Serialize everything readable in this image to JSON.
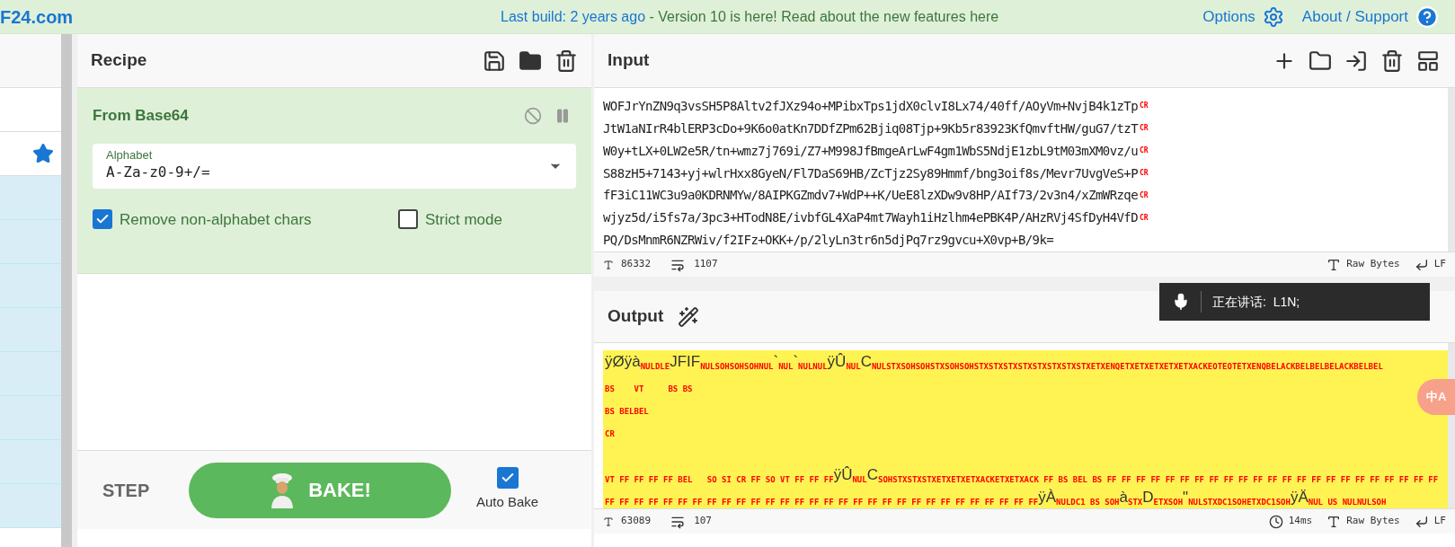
{
  "banner": {
    "logo": "F24.com",
    "build_link": "Last build: 2 years ago",
    "notice": " - Version 10 is here! Read about the new features here",
    "options": "Options",
    "about": "About / Support"
  },
  "recipe": {
    "title": "Recipe",
    "operation": {
      "name": "From Base64",
      "disabled": false,
      "paused": false,
      "alphabet_label": "Alphabet",
      "alphabet": "A-Za-z0-9+/=",
      "checkboxes": [
        {
          "label": "Remove non-alphabet chars",
          "checked": true
        },
        {
          "label": "Strict mode",
          "checked": false
        }
      ]
    },
    "step": "STEP",
    "bake": "BAKE!",
    "auto_bake": {
      "label": "Auto Bake",
      "checked": true
    }
  },
  "input": {
    "title": "Input",
    "lines": [
      {
        "text": "WOFJrYnZN9q3vsSH5P8Altv2fJXz94o+MPibxTps1jdX0clvI8Lx74/40ff/AOyVm+NvjB4k1zTp",
        "end": "CR"
      },
      {
        "text": "JtW1aNIrR4blERP3cDo+9K6o0atKn7DDfZPm62Bjiq08Tjp+9Kb5r83923KfQmvftHW/guG7/tzT",
        "end": "CR"
      },
      {
        "text": "W0y+tLX+0LW2e5R/tn+wmz7j769i/Z7+M998JfBmgeArLwF4gm1WbS5NdjE1zbL9tM03mXM0vz/u",
        "end": "CR"
      },
      {
        "text": "S88zH5+7143+yj+wlrHxx8GyeN/Fl7DaS69HB/ZcTjz2Sy89Hmmf/bng3oif8s/Mevr7UvgVeS+P",
        "end": "CR"
      },
      {
        "text": "fF3iC11WC3u9a0KDRNMYw/8AIPKGZmdv7+WdP++K/UeE8lzXDw9v8HP/AIf73/2v3n4/xZmWRzqe",
        "end": "CR"
      },
      {
        "text": "wjyz5d/i5fs7a/3pc3+HTodN8E/ivbfGL4XaP4mt7Wayh1iHzlhm4ePBK4P/AHzRVj4SfDyH4VfD",
        "end": "CR"
      },
      {
        "text": "PQ/DsMnmR6NZRWiv/f2IFz+OKK+/p/2lyLn3tr6n5djPq7rz9gvcu+X0vp+B/9k="
      }
    ],
    "length": "86332",
    "lines_count": "1107",
    "encoding": "Raw Bytes",
    "eol": "LF"
  },
  "output": {
    "title": "Output",
    "lines": [
      {
        "kind": "text",
        "segments": [
          {
            "kind": "char",
            "text": "ÿØÿà"
          },
          {
            "kind": "ctrl",
            "text": "NULDLE"
          },
          {
            "kind": "char",
            "text": "JFIF"
          },
          {
            "kind": "ctrl",
            "text": "NULSOHSOHSOHNUL"
          },
          {
            "kind": "char",
            "text": "`"
          },
          {
            "kind": "ctrl",
            "text": "NUL"
          },
          {
            "kind": "char",
            "text": "`"
          },
          {
            "kind": "ctrl",
            "text": "NULNUL"
          },
          {
            "kind": "char",
            "text": "ÿÛ"
          },
          {
            "kind": "ctrl",
            "text": "NUL"
          },
          {
            "kind": "char",
            "text": "C"
          },
          {
            "kind": "ctrl",
            "text": "NULSTXSOHSOHSTXSOHSOHSTXSTXSTXSTXSTXSTXSTXSTXETXENQETXETXETXETXETXACKEOTEOTETXENQBELACKBELBELBELACKBELBEL"
          }
        ]
      },
      {
        "kind": "text",
        "segments": [
          {
            "kind": "ctrl",
            "text": "BS    VT     BS BS"
          }
        ]
      },
      {
        "kind": "text",
        "segments": [
          {
            "kind": "ctrl",
            "text": "BS BELBEL"
          }
        ]
      },
      {
        "kind": "text",
        "segments": [
          {
            "kind": "ctrl",
            "text": "CR"
          }
        ]
      },
      {
        "kind": "blank"
      },
      {
        "kind": "text",
        "segments": [
          {
            "kind": "ctrl",
            "text": "VT FF FF FF FF BEL   SO SI CR FF SO VT FF FF FF"
          },
          {
            "kind": "char",
            "text": "ÿÛ"
          },
          {
            "kind": "ctrl",
            "text": "NUL"
          },
          {
            "kind": "char",
            "text": "C"
          },
          {
            "kind": "ctrl",
            "text": "SOHSTXSTXSTXETXETXETXACKETXETXACK FF BS BEL BS FF FF FF FF FF FF FF FF FF FF FF FF FF FF FF FF FF FF FF FF FF FF FF"
          }
        ]
      },
      {
        "kind": "text",
        "segments": [
          {
            "kind": "ctrl",
            "text": "FF FF FF FF FF FF FF FF FF FF FF FF FF FF FF FF FF FF FF FF FF FF FF FF FF FF FF FF FF FF"
          },
          {
            "kind": "char",
            "text": "ÿÀ"
          },
          {
            "kind": "ctrl",
            "text": "NULDC1 BS SOH"
          },
          {
            "kind": "char",
            "text": "à"
          },
          {
            "kind": "ctrl",
            "text": "STX"
          },
          {
            "kind": "char",
            "text": "D"
          },
          {
            "kind": "ctrl",
            "text": "ETXSOH"
          },
          {
            "kind": "char",
            "text": "\""
          },
          {
            "kind": "ctrl",
            "text": "NULSTXDC1SOHETXDC1SOH"
          },
          {
            "kind": "char",
            "text": "ÿÄ"
          },
          {
            "kind": "ctrl",
            "text": "NUL US NULNULSOH"
          }
        ]
      }
    ],
    "length": "63089",
    "lines_count": "107",
    "time": "14ms",
    "encoding": "Raw Bytes",
    "eol": "LF"
  },
  "speech_overlay": {
    "text": "正在讲话:  L1N;"
  },
  "translate_button": {
    "label": "中A"
  }
}
